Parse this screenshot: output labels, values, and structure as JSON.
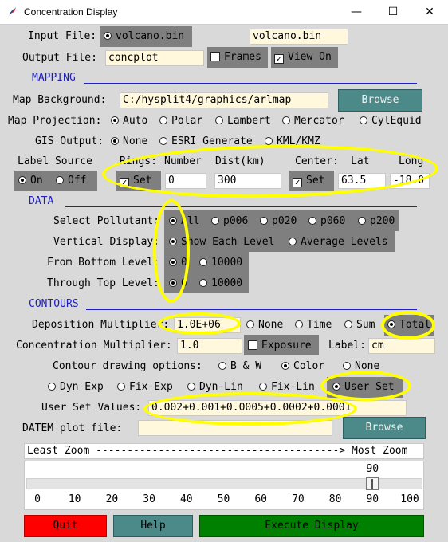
{
  "window": {
    "title": "Concentration Display",
    "minimize_glyph": "—",
    "maximize_glyph": "☐",
    "close_glyph": "✕"
  },
  "input": {
    "label": "Input File:",
    "radio_value": "volcano.bin",
    "entry_value": "volcano.bin"
  },
  "output": {
    "label": "Output File:",
    "value": "concplot",
    "frames_label": "Frames",
    "view_on_label": "View On",
    "frames_checked": false,
    "view_on_checked": true
  },
  "mapping": {
    "section": "MAPPING",
    "background_label": "Map Background:",
    "background_value": "C:/hysplit4/graphics/arlmap",
    "browse": "Browse",
    "projection_label": "Map Projection:",
    "projections": [
      "Auto",
      "Polar",
      "Lambert",
      "Mercator",
      "CylEquid"
    ],
    "projection_selected": "Auto",
    "gis_label": "GIS Output:",
    "gis_options": [
      "None",
      "ESRI Generate",
      "KML/KMZ"
    ],
    "gis_selected": "None"
  },
  "label_source": {
    "label": "Label Source",
    "on": "On",
    "off": "Off",
    "selected": "On"
  },
  "rings": {
    "label": "Rings:",
    "number_label": "Number",
    "dist_label": "Dist(km)",
    "set_label": "Set",
    "set_checked": true,
    "number": "0",
    "dist": "300"
  },
  "center": {
    "label": "Center:",
    "lat_label": "Lat",
    "long_label": "Long",
    "set_label": "Set",
    "set_checked": true,
    "lat": "63.5",
    "long": "-18.0"
  },
  "data": {
    "section": "DATA",
    "pollutant_label": "Select Pollutant:",
    "pollutants": [
      "All",
      "p006",
      "p020",
      "p060",
      "p200"
    ],
    "pollutant_selected": "All",
    "vertical_label": "Vertical Display:",
    "vertical_options": [
      "Show Each Level",
      "Average Levels"
    ],
    "vertical_selected": "Show Each Level",
    "bottom_label": "From Bottom Level:",
    "bottom_options": [
      "0",
      "10000"
    ],
    "bottom_selected": "0",
    "top_label": "Through Top Level:",
    "top_options": [
      "0",
      "10000"
    ],
    "top_selected": "0"
  },
  "contours": {
    "section": "CONTOURS",
    "deposition_label": "Deposition Multiplier:",
    "deposition_value": "1.0E+06",
    "deposition_options": [
      "None",
      "Time",
      "Sum",
      "Total"
    ],
    "deposition_selected": "Total",
    "concentration_label": "Concentration Multiplier:",
    "concentration_value": "1.0",
    "exposure_label": "Exposure",
    "exposure_checked": false,
    "units_label": "Label:",
    "units_value": "cm",
    "drawing_label": "Contour drawing options:",
    "drawing_options": [
      "B & W",
      "Color",
      "None"
    ],
    "drawing_selected": "Color",
    "levels_options": [
      "Dyn-Exp",
      "Fix-Exp",
      "Dyn-Lin",
      "Fix-Lin",
      "User Set"
    ],
    "levels_selected": "User Set",
    "user_values_label": "User Set Values:",
    "user_values": "0.002+0.001+0.0005+0.0002+0.0001"
  },
  "datem": {
    "label": "DATEM plot file:",
    "value": "",
    "browse": "Browse"
  },
  "zoom": {
    "header": "Least Zoom ---------------------------------------> Most Zoom",
    "value": 90,
    "value_text": "90",
    "ticks": [
      "0",
      "10",
      "20",
      "30",
      "40",
      "50",
      "60",
      "70",
      "80",
      "90",
      "100"
    ]
  },
  "buttons": {
    "quit": "Quit",
    "help": "Help",
    "execute": "Execute Display"
  },
  "colors": {
    "accent": "#4c8a8a",
    "highlight": "#ffff00",
    "quit": "#ff0000",
    "execute": "#008000",
    "section": "#2020c0"
  }
}
